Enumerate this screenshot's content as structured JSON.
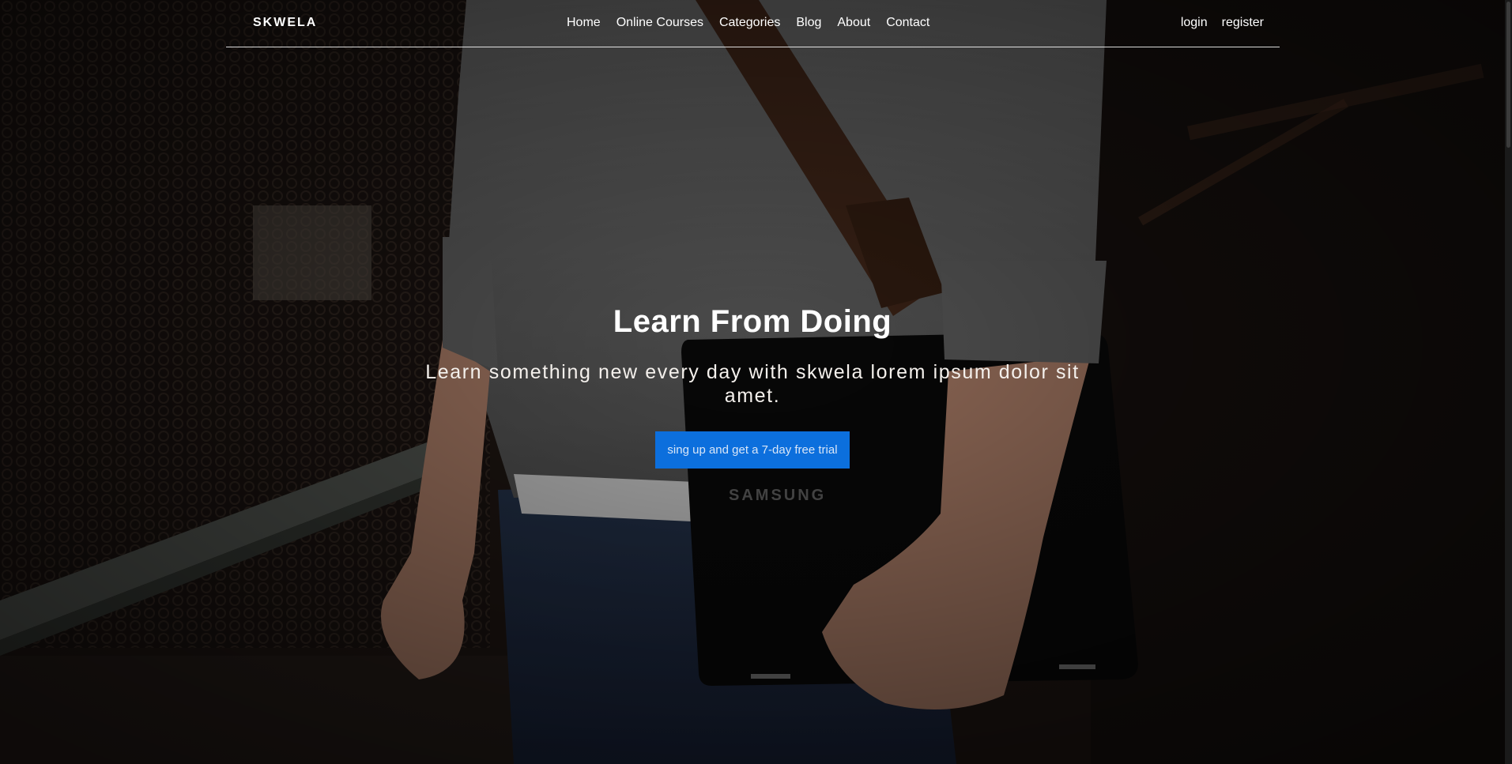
{
  "nav": {
    "brand": "SKWELA",
    "links": [
      "Home",
      "Online Courses",
      "Categories",
      "Blog",
      "About",
      "Contact"
    ],
    "auth": {
      "login": "login",
      "register": "register"
    }
  },
  "hero": {
    "title": "Learn From Doing",
    "subtitle": "Learn something new every day with skwela lorem ipsum dolor sit amet.",
    "cta_label": "sing up and get a 7-day free trial",
    "image_text": "SAMSUNG"
  },
  "colors": {
    "cta": "#0c6fdd",
    "text": "#ffffff"
  }
}
